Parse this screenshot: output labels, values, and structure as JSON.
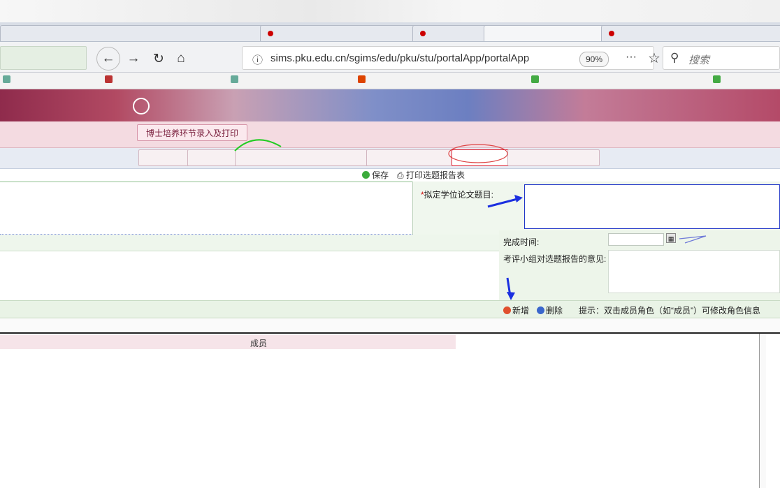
{
  "browser": {
    "url": "sims.pku.edu.cn/sgims/edu/pku/stu/portalApp/portalApp",
    "zoom": "90%",
    "search_placeholder": "搜索",
    "more_label": "···"
  },
  "page": {
    "tab_label": "博士培养环节录入及打印"
  },
  "toolbar": {
    "save_label": "保存",
    "print_label": "打印选题报告表"
  },
  "form": {
    "thesis_title_required": "*",
    "thesis_title_label": "拟定学位论文题目:",
    "completion_time_label": "完成时间:",
    "committee_opinion_label": "考评小组对选题报告的意见:"
  },
  "members": {
    "add_label": "新增",
    "delete_label": "删除",
    "hint": "提示：双击成员角色（如“成员”）可修改角色信息",
    "row_role": "成员"
  },
  "colors": {
    "accent_green": "#3bab3b",
    "annotation_blue": "#1b2fe0",
    "annotation_green": "#22cc22",
    "input_border_blue": "#2238c8"
  }
}
